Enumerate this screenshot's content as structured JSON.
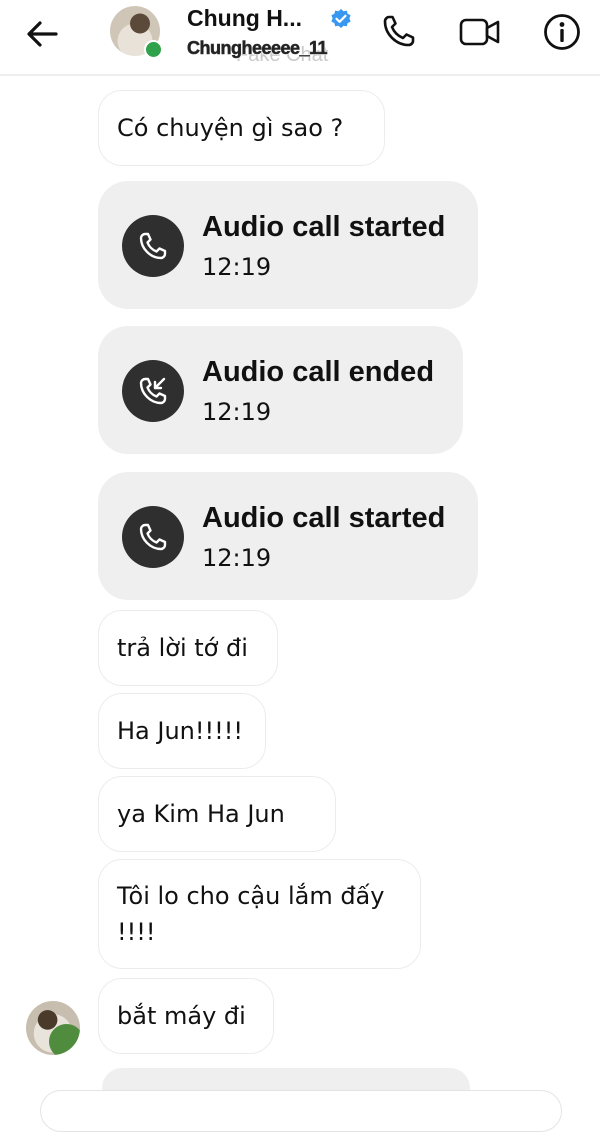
{
  "header": {
    "contact_name": "Chung H...",
    "username": "Chungheeeee_11",
    "watermark": "Fake Chat",
    "icons": [
      "back-arrow-icon",
      "verified-badge-icon",
      "phone-icon",
      "video-camera-icon",
      "info-icon"
    ],
    "online_color": "#31a24c",
    "verified_color": "#3897f0"
  },
  "messages": [
    {
      "type": "text",
      "text": "Có chuyện gì sao ?"
    },
    {
      "type": "call",
      "title": "Audio call started",
      "time": "12:19",
      "icon": "phone-icon"
    },
    {
      "type": "call",
      "title": "Audio call ended",
      "time": "12:19",
      "icon": "phone-incoming-icon"
    },
    {
      "type": "call",
      "title": "Audio call started",
      "time": "12:19",
      "icon": "phone-icon"
    },
    {
      "type": "text",
      "text": "trả lời tớ đi"
    },
    {
      "type": "text",
      "text": "Ha Jun!!!!!"
    },
    {
      "type": "text",
      "text": "ya Kim Ha Jun"
    },
    {
      "type": "text",
      "text": "Tôi lo cho cậu lắm đấy !!!!"
    },
    {
      "type": "text",
      "text": "bắt máy đi"
    }
  ]
}
